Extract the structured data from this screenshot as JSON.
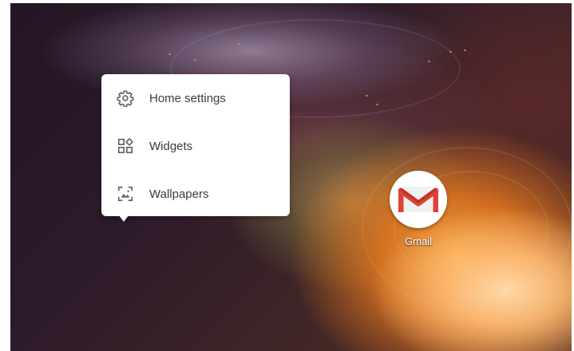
{
  "popup_menu": {
    "items": [
      {
        "label": "Home settings",
        "icon": "gear-icon"
      },
      {
        "label": "Widgets",
        "icon": "widgets-icon"
      },
      {
        "label": "Wallpapers",
        "icon": "wallpaper-icon"
      }
    ]
  },
  "home_apps": [
    {
      "label": "Gmail",
      "icon": "gmail-icon"
    }
  ],
  "colors": {
    "menu_background": "#ffffff",
    "menu_text": "#3c3c3c",
    "icon_gray": "#5f6368",
    "gmail_red": "#db4437"
  }
}
